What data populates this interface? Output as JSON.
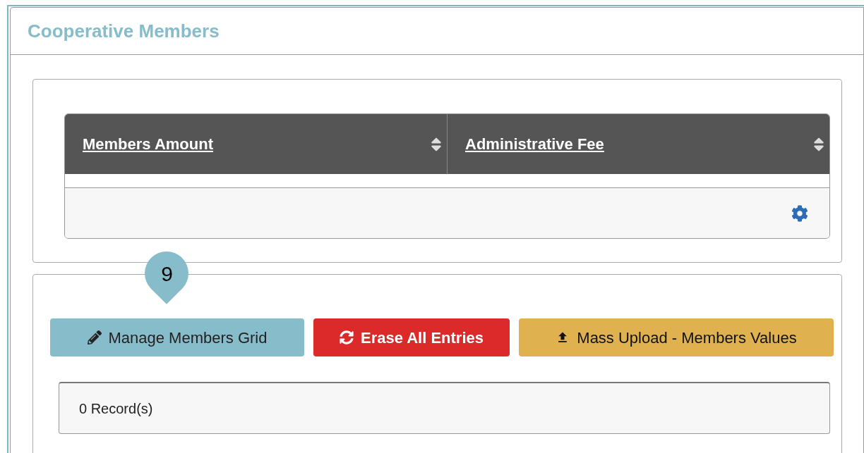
{
  "panel": {
    "title": "Cooperative Members"
  },
  "table": {
    "columns": [
      {
        "label": "Members Amount"
      },
      {
        "label": "Administrative Fee"
      }
    ]
  },
  "buttons": [
    {
      "label": "Manage Members Grid",
      "kind": "info"
    },
    {
      "label": "Erase All Entries",
      "kind": "danger"
    },
    {
      "label": "Mass Upload - Members Values",
      "kind": "warning"
    }
  ],
  "step_marker": {
    "label": "9"
  },
  "records": {
    "label": "0 Record(s)"
  }
}
